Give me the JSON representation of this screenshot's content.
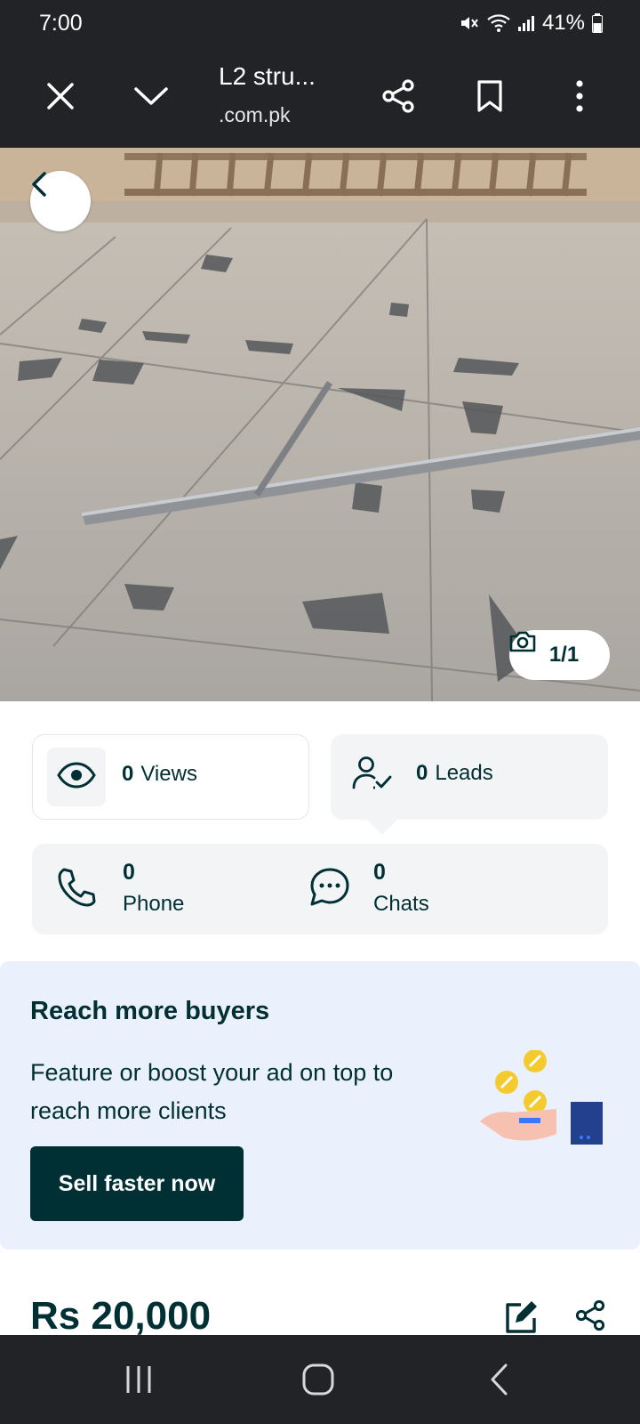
{
  "status_bar": {
    "time": "7:00",
    "battery": "41%"
  },
  "browser": {
    "title": "L2 stru...",
    "url": ".com.pk"
  },
  "gallery": {
    "photo_count": "1/1"
  },
  "stats": {
    "views": {
      "value": "0",
      "label": "Views"
    },
    "leads": {
      "value": "0",
      "label": "Leads"
    },
    "phone": {
      "value": "0",
      "label": "Phone"
    },
    "chats": {
      "value": "0",
      "label": "Chats"
    }
  },
  "promo": {
    "title": "Reach more buyers",
    "body": "Feature or boost your ad on top to reach more clients",
    "cta": "Sell faster now"
  },
  "listing": {
    "price": "Rs 20,000"
  },
  "colors": {
    "brand_dark": "#002f34",
    "promo_bg": "#ebf1fc",
    "chrome": "#222326",
    "card_bg": "#f2f4f5"
  }
}
